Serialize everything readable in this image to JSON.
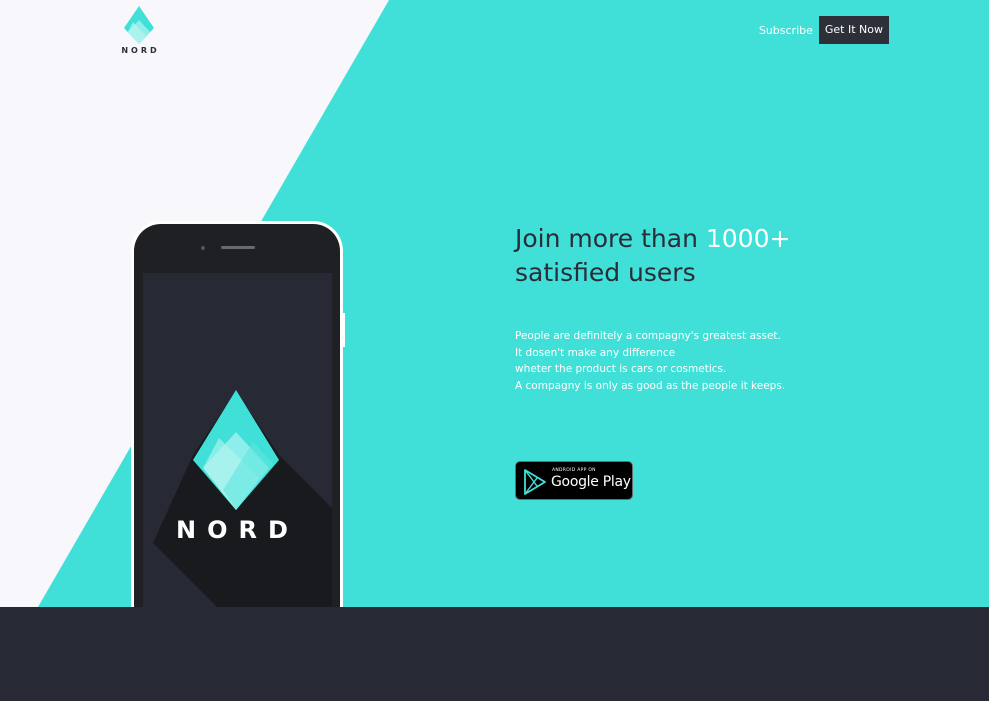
{
  "brand": {
    "name": "NORD",
    "phone_name": "NORD",
    "colors": {
      "accent": "#40e0d8",
      "dark": "#272a35",
      "light": "#f8f8fc"
    }
  },
  "nav": {
    "subscribe_label": "Subscribe",
    "cta_label": "Get It Now"
  },
  "hero": {
    "headline_part1": "Join more than ",
    "headline_accent": "1000+",
    "headline_part2": "satisfied users",
    "description_lines": [
      "People are definitely a compagny's greatest asset.",
      "It dosen't make any difference",
      "wheter the product is cars or cosmetics.",
      "A compagny is only as good as the people it keeps."
    ]
  },
  "store_badge": {
    "small_text": "ANDROID APP ON",
    "big_text": "Google Play",
    "icon": "google-play-icon"
  }
}
